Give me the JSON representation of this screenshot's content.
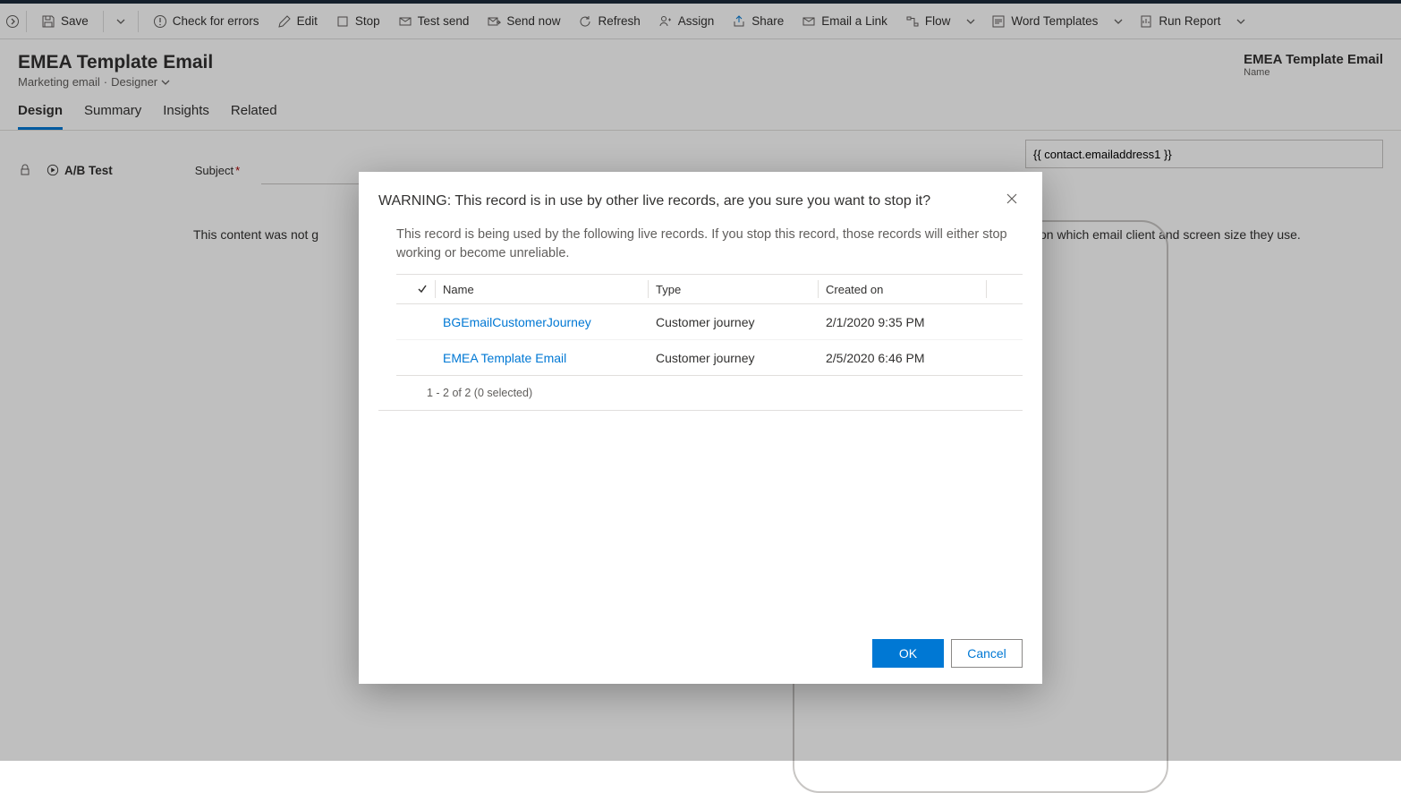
{
  "toolbar": {
    "save": "Save",
    "check_errors": "Check for errors",
    "edit": "Edit",
    "stop": "Stop",
    "test_send": "Test send",
    "send_now": "Send now",
    "refresh": "Refresh",
    "assign": "Assign",
    "share": "Share",
    "email_link": "Email a Link",
    "flow": "Flow",
    "word_templates": "Word Templates",
    "run_report": "Run Report"
  },
  "header": {
    "title": "EMEA Template Email",
    "subtitle_entity": "Marketing email",
    "subtitle_view": "Designer",
    "right_title": "EMEA Template Email",
    "right_sub": "Name"
  },
  "tabs": {
    "design": "Design",
    "summary": "Summary",
    "insights": "Insights",
    "related": "Related"
  },
  "form": {
    "ab_test": "A/B Test",
    "subject_label": "Subject",
    "to_value": "{{ contact.emailaddress1 }}"
  },
  "content_info_prefix": "This content was not g",
  "content_info_suffix": "nding on which email client and screen size they use.",
  "modal": {
    "title": "WARNING: This record is in use by other live records, are you sure you want to stop it?",
    "body": "This record is being used by the following live records. If you stop this record, those records will either stop working or become unreliable.",
    "col_name": "Name",
    "col_type": "Type",
    "col_created": "Created on",
    "rows": [
      {
        "name": "BGEmailCustomerJourney",
        "type": "Customer journey",
        "created": "2/1/2020 9:35 PM"
      },
      {
        "name": "EMEA Template Email",
        "type": "Customer journey",
        "created": "2/5/2020 6:46 PM"
      }
    ],
    "footer_count": "1 - 2 of 2 (0 selected)",
    "ok": "OK",
    "cancel": "Cancel"
  }
}
